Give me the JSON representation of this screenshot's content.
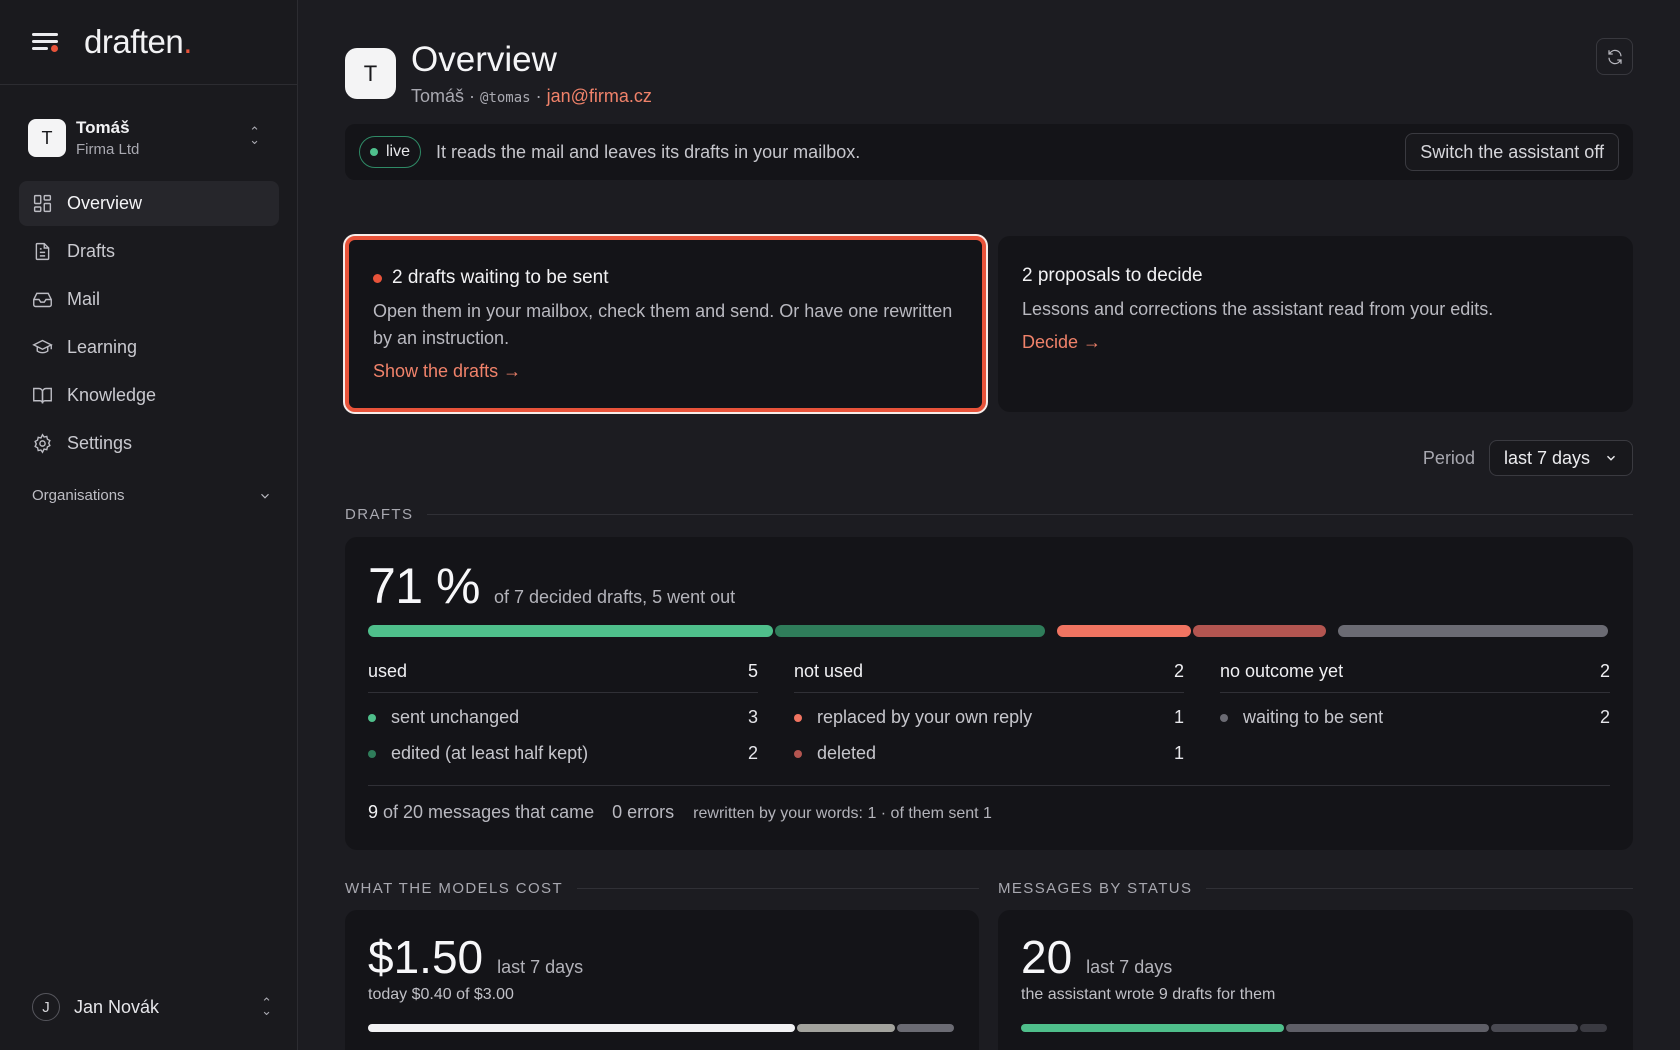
{
  "brand": {
    "name": "draften",
    "dot": "."
  },
  "account": {
    "initial": "T",
    "name": "Tomáš",
    "org": "Firma Ltd"
  },
  "nav": [
    {
      "label": "Overview",
      "icon": "grid-icon",
      "active": true
    },
    {
      "label": "Drafts",
      "icon": "document-icon",
      "active": false
    },
    {
      "label": "Mail",
      "icon": "inbox-icon",
      "active": false
    },
    {
      "label": "Learning",
      "icon": "graduation-cap-icon",
      "active": false
    },
    {
      "label": "Knowledge",
      "icon": "book-icon",
      "active": false
    },
    {
      "label": "Settings",
      "icon": "gear-icon",
      "active": false
    }
  ],
  "organisations_label": "Organisations",
  "user": {
    "initial": "J",
    "name": "Jan Novák"
  },
  "header": {
    "initial": "T",
    "title": "Overview",
    "name": "Tomáš",
    "sep": " · ",
    "handle": "@tomas",
    "email": "jan@firma.cz"
  },
  "status": {
    "badge": "live",
    "text": "It reads the mail and leaves its drafts in your mailbox.",
    "switch_label": "Switch the assistant off"
  },
  "cards": {
    "drafts_waiting": {
      "title": "2 drafts waiting to be sent",
      "desc": "Open them in your mailbox, check them and send. Or have one rewritten by an instruction.",
      "link": "Show the drafts →"
    },
    "proposals": {
      "title": "2 proposals to decide",
      "desc": "Lessons and corrections the assistant read from your edits.",
      "link": "Decide →"
    }
  },
  "period": {
    "label": "Period",
    "selected": "last 7 days"
  },
  "drafts": {
    "section": "DRAFTS",
    "percent": "71 %",
    "caption": "of 7 decided drafts, 5 went out",
    "bar": [
      {
        "name": "sent unchanged",
        "value": 3,
        "color": "#4fbf8b"
      },
      {
        "name": "edited",
        "value": 2,
        "color": "#2f7d5a"
      },
      {
        "name": "replaced",
        "value": 1,
        "color": "#f07461"
      },
      {
        "name": "deleted",
        "value": 1,
        "color": "#b35550"
      },
      {
        "name": "waiting",
        "value": 2,
        "color": "#6b6b73"
      }
    ],
    "groups": [
      {
        "title": "used",
        "count": "5",
        "rows": [
          {
            "label": "sent unchanged",
            "count": "3",
            "color": "#4fbf8b"
          },
          {
            "label": "edited (at least half kept)",
            "count": "2",
            "color": "#2f7d5a"
          }
        ]
      },
      {
        "title": "not used",
        "count": "2",
        "rows": [
          {
            "label": "replaced by your own reply",
            "count": "1",
            "color": "#f07461"
          },
          {
            "label": "deleted",
            "count": "1",
            "color": "#b35550"
          }
        ]
      },
      {
        "title": "no outcome yet",
        "count": "2",
        "rows": [
          {
            "label": "waiting to be sent",
            "count": "2",
            "color": "#6b6b73"
          }
        ]
      }
    ],
    "footer": {
      "messages_num": "9",
      "messages_text": " of 20 messages that came",
      "errors": "0 errors",
      "rewritten": "rewritten by your words: 1 · of them sent 1"
    }
  },
  "cost": {
    "section": "WHAT THE MODELS COST",
    "amount": "$1.50",
    "period": "last 7 days",
    "today": "today $0.40 of $3.00",
    "bar": [
      {
        "value": 0.73,
        "color": "#f2f2f4"
      },
      {
        "value": 0.17,
        "color": "#a3a39d"
      },
      {
        "value": 0.1,
        "color": "#6b6b73"
      }
    ]
  },
  "messages": {
    "section": "MESSAGES BY STATUS",
    "count": "20",
    "period": "last 7 days",
    "sub": "the assistant wrote 9 drafts for them",
    "bar": [
      {
        "value": 0.45,
        "color": "#4fbf8b"
      },
      {
        "value": 0.35,
        "color": "#5f5f67"
      },
      {
        "value": 0.15,
        "color": "#4a4a52"
      },
      {
        "value": 0.05,
        "color": "#3a3a41"
      }
    ]
  }
}
